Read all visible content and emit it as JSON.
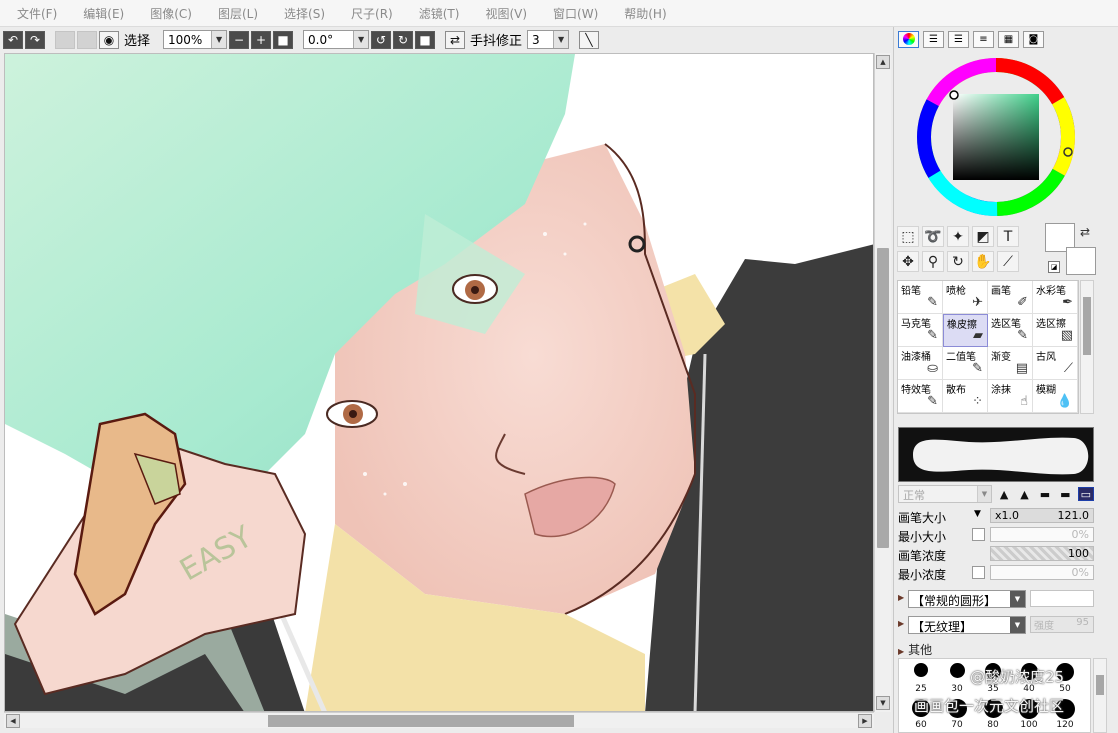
{
  "menu": [
    "文件(F)",
    "编辑(E)",
    "图像(C)",
    "图层(L)",
    "选择(S)",
    "尺子(R)",
    "滤镜(T)",
    "视图(V)",
    "窗口(W)",
    "帮助(H)"
  ],
  "toolbar": {
    "view_label": "选择",
    "zoom": "100%",
    "rotation": "0.0°",
    "stabilizer_label": "手抖修正",
    "stabilizer_value": "3"
  },
  "brushes": [
    {
      "name": "铅笔",
      "icon": "pencil-icon"
    },
    {
      "name": "喷枪",
      "icon": "airbrush-icon"
    },
    {
      "name": "画笔",
      "icon": "brush-icon"
    },
    {
      "name": "水彩笔",
      "icon": "watercolor-icon"
    },
    {
      "name": "马克笔",
      "icon": "marker-icon"
    },
    {
      "name": "橡皮擦",
      "icon": "eraser-icon"
    },
    {
      "name": "选区笔",
      "icon": "selection-pen-icon"
    },
    {
      "name": "选区擦",
      "icon": "selection-eraser-icon"
    },
    {
      "name": "油漆桶",
      "icon": "bucket-icon"
    },
    {
      "name": "二值笔",
      "icon": "binary-pen-icon"
    },
    {
      "name": "渐变",
      "icon": "gradient-icon"
    },
    {
      "name": "古风",
      "icon": "ancient-brush-icon"
    },
    {
      "name": "特效笔",
      "icon": "effect-pen-icon"
    },
    {
      "name": "散布",
      "icon": "scatter-icon"
    },
    {
      "name": "涂抹",
      "icon": "smudge-icon"
    },
    {
      "name": "模糊",
      "icon": "blur-icon"
    }
  ],
  "active_brush": "橡皮擦",
  "blend_mode": "正常",
  "params": {
    "size_label": "画笔大小",
    "size_multiplier": "x1.0",
    "size_value": "121.0",
    "min_size_label": "最小大小",
    "min_size_value": "0%",
    "density_label": "画笔浓度",
    "density_value": "100",
    "min_density_label": "最小浓度",
    "min_density_value": "0%"
  },
  "shape_combo": "【常规的圆形】",
  "texture_combo": "【无纹理】",
  "texture_strength_label": "强度",
  "texture_strength_value": "95",
  "other_label": "其他",
  "dot_sizes": [
    "25",
    "30",
    "35",
    "40",
    "50",
    "60",
    "70",
    "80",
    "100",
    "120"
  ],
  "watermark": [
    "@酸奶浓度25",
    "画画包一次元文创社区"
  ],
  "colors": {
    "accent_selected": "#8b8bd6",
    "canvas_bg": "#ffffff"
  }
}
